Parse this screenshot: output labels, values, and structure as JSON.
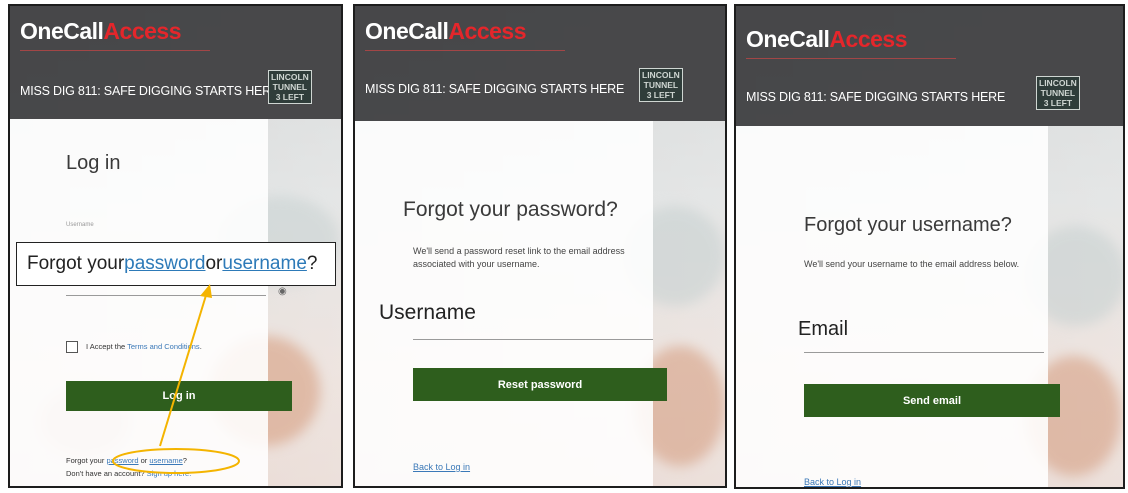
{
  "brand": {
    "one": "OneCall",
    "access": "Access",
    "accent": "#e4262b"
  },
  "tagline": "MISS DIG 811: SAFE DIGGING STARTS HERE",
  "street_sign": [
    "LINCOLN",
    "TUNNEL",
    "3 LEFT"
  ],
  "colors": {
    "button": "#2e5e1d",
    "header": "#3c3c3e",
    "link": "#3b79b8"
  },
  "login": {
    "title": "Log in",
    "username_label": "Username",
    "callout": {
      "prefix": "Forgot your ",
      "password": "password",
      "or": " or ",
      "username": "username",
      "suffix": "?"
    },
    "accept_prefix": "I Accept the ",
    "terms_link": "Terms and Conditions",
    "accept_suffix": ".",
    "login_button": "Log in",
    "forgot": {
      "prefix": "Forgot your ",
      "password": "password",
      "or": " or ",
      "username": "username",
      "suffix": "?"
    },
    "signup_prefix": "Don't have an account? ",
    "signup_link": "Sign up here."
  },
  "forgot_password": {
    "title": "Forgot your password?",
    "note": "We'll send a password reset link to the email address associated with your username.",
    "field_label": "Username",
    "button": "Reset password",
    "back_link": "Back to Log in"
  },
  "forgot_username": {
    "title": "Forgot your username?",
    "note": "We'll send your username to the email address below.",
    "field_label": "Email",
    "button": "Send email",
    "back_link": "Back to Log in"
  }
}
